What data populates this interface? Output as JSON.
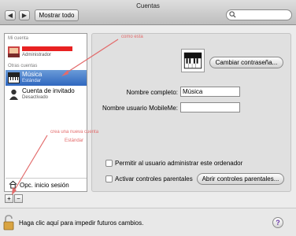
{
  "window": {
    "title": "Cuentas"
  },
  "toolbar": {
    "back_icon": "◀",
    "forward_icon": "▶",
    "show_all_label": "Mostrar todo",
    "search_placeholder": ""
  },
  "sidebar": {
    "my_account_header": "Mi cuenta",
    "my_account": {
      "name": "",
      "role": "Administrador"
    },
    "other_accounts_header": "Otras cuentas",
    "accounts": [
      {
        "name": "Música",
        "role": "Estándar",
        "selected": true
      },
      {
        "name": "Cuenta de invitado",
        "role": "Desactivado",
        "selected": false
      }
    ],
    "login_options_label": "Opc. inicio sesión",
    "add_label": "+",
    "remove_label": "−"
  },
  "detail": {
    "change_password_label": "Cambiar contraseña...",
    "full_name_label": "Nombre completo:",
    "full_name_value": "Música",
    "mobileme_label": "Nombre usuario MobileMe:",
    "mobileme_value": "",
    "admin_checkbox_label": "Permitir al usuario administrar este ordenador",
    "admin_checked": false,
    "parental_checkbox_label": "Activar controles parentales",
    "parental_checked": false,
    "open_parental_label": "Abrir controles parentales..."
  },
  "annotations": {
    "top": "como esta",
    "bottom_1": "crea una nueva cuenta",
    "bottom_2": "Estándar"
  },
  "bottom": {
    "lock_label": "Haga clic aquí para impedir futuros cambios.",
    "help_label": "?"
  },
  "colors": {
    "selection": "#3a70c4",
    "annotation": "#e36b6b",
    "redaction": "#e82222"
  }
}
